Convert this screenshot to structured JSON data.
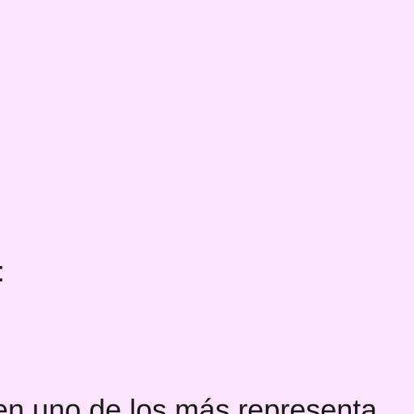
{
  "document": {
    "fragment_colon": ":",
    "fragment_line": "en uno de los más representa"
  },
  "colors": {
    "background": "#fde4fd",
    "text": "#1a1a1a"
  }
}
